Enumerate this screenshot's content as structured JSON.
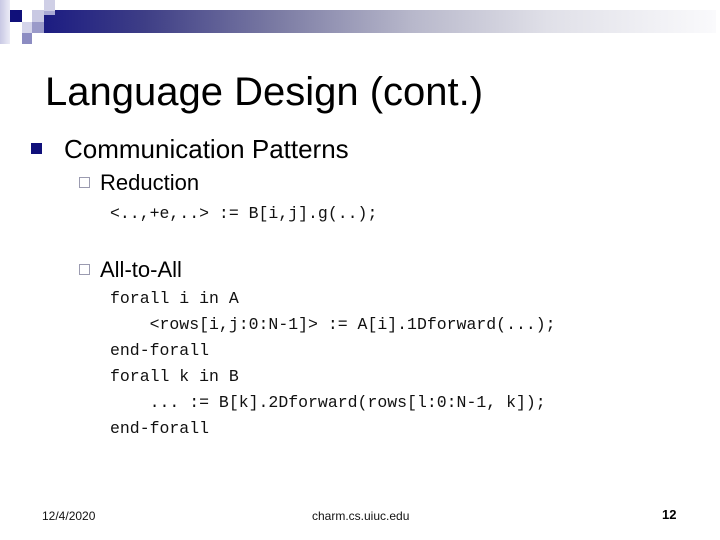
{
  "slide": {
    "title": "Language Design (cont.)",
    "bullets": [
      {
        "icon": "filled-square-bullet-icon",
        "text": "Communication Patterns",
        "subitems": [
          {
            "icon": "hollow-square-bullet-icon",
            "text": "Reduction",
            "code": [
              "<..,+e,..> := B[i,j].g(..);"
            ]
          },
          {
            "icon": "hollow-square-bullet-icon",
            "text": "All-to-All",
            "code": [
              "forall i in A",
              "    <rows[i,j:0:N-1]> := A[i].1Dforward(...);",
              "end-forall",
              "forall k in B",
              "    ... := B[k].2Dforward(rows[l:0:N-1, k]);",
              "end-forall"
            ]
          }
        ]
      }
    ]
  },
  "footer": {
    "date": "12/4/2020",
    "site": "charm.cs.uiuc.edu",
    "page_number": "12"
  },
  "theme": {
    "accent": "#10107a",
    "bar_start": "#1c1c82",
    "bar_end": "#fafafc",
    "box_border": "#9b9bb0"
  }
}
